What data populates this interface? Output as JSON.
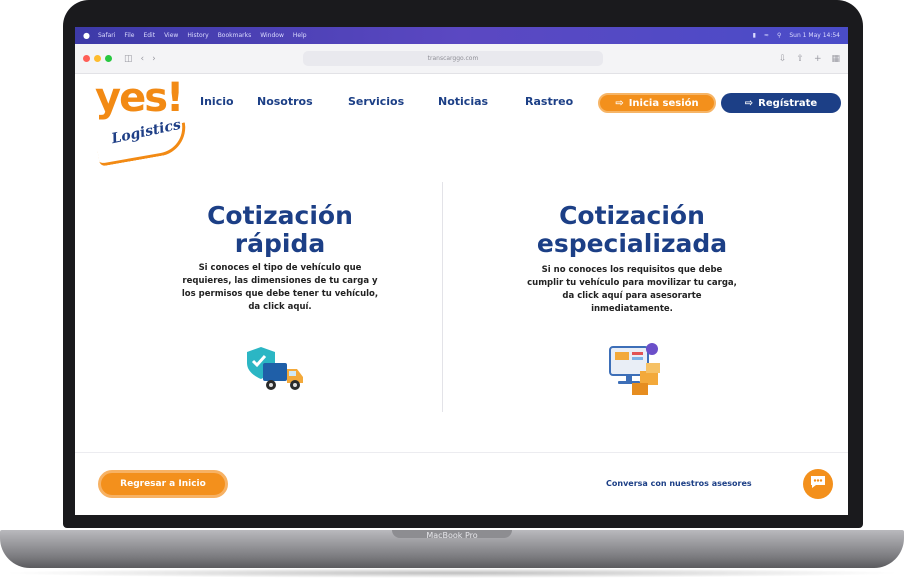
{
  "os_menubar": {
    "items": [
      "Safari",
      "File",
      "Edit",
      "View",
      "History",
      "Bookmarks",
      "Window",
      "Help"
    ],
    "clock": "Sun 1 May 14:54"
  },
  "browser": {
    "url": "transcarggo.com"
  },
  "brand": {
    "logo_top": "yes!",
    "logo_bottom": "Logistics",
    "primary_color": "#1c3f86",
    "accent_color": "#f3901c"
  },
  "nav": {
    "items": [
      "Inicio",
      "Nosotros",
      "Servicios",
      "Noticias",
      "Rastreo"
    ],
    "login_label": "Inicia sesión",
    "register_label": "Regístrate"
  },
  "quick_quote": {
    "title_line1": "Cotización",
    "title_line2": "rápida",
    "text_lines": [
      "Si conoces el tipo de vehículo que",
      "requieres, las dimensiones de tu carga y",
      "los permisos que debe tener tu vehículo,",
      "da click aquí."
    ],
    "icon": "truck-shield-icon"
  },
  "special_quote": {
    "title_line1": "Cotización",
    "title_line2": "especializada",
    "text_lines": [
      "Si no conoces los requisitos que debe",
      "cumplir tu vehículo para movilizar tu carga,",
      "da click aquí para asesorarte",
      "inmediatamente."
    ],
    "icon": "monitor-boxes-icon"
  },
  "footer": {
    "back_label": "Regresar a Inicio",
    "chat_label": "Conversa con nuestros asesores",
    "chat_icon": "chat-bubble-icon"
  },
  "device": {
    "label": "MacBook Pro"
  }
}
